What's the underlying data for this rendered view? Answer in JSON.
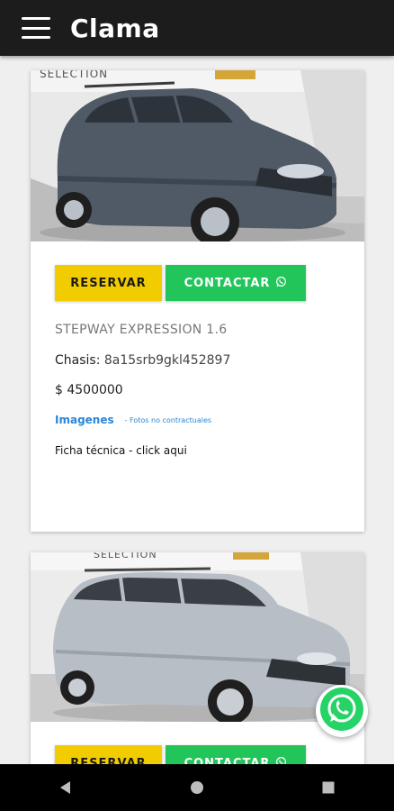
{
  "app": {
    "title": "Clama"
  },
  "cards": [
    {
      "reserve_label": "RESERVAR",
      "contact_label": "CONTACTAR",
      "model": "STEPWAY EXPRESSION 1.6",
      "chasis_label": "Chasis:",
      "chasis_value": "8a15srb9gkl452897",
      "price": "$ 4500000",
      "images_link": "Imagenes",
      "disclaimer": "- Fotos no contractuales",
      "ficha": "Ficha técnica - click aqui",
      "photo_sign": "SELECTION"
    },
    {
      "reserve_label": "RESERVAR",
      "contact_label": "CONTACTAR",
      "photo_sign": "SELECTION"
    }
  ],
  "icons": {
    "menu": "hamburger-menu-icon",
    "whatsapp": "whatsapp-icon",
    "back": "back-triangle-icon",
    "home": "home-circle-icon",
    "recents": "recents-square-icon"
  },
  "colors": {
    "appbar": "#1c1c1c",
    "reserve": "#f0cc00",
    "contact": "#22c55a",
    "link": "#2a86d6",
    "whatsapp": "#25d366"
  }
}
